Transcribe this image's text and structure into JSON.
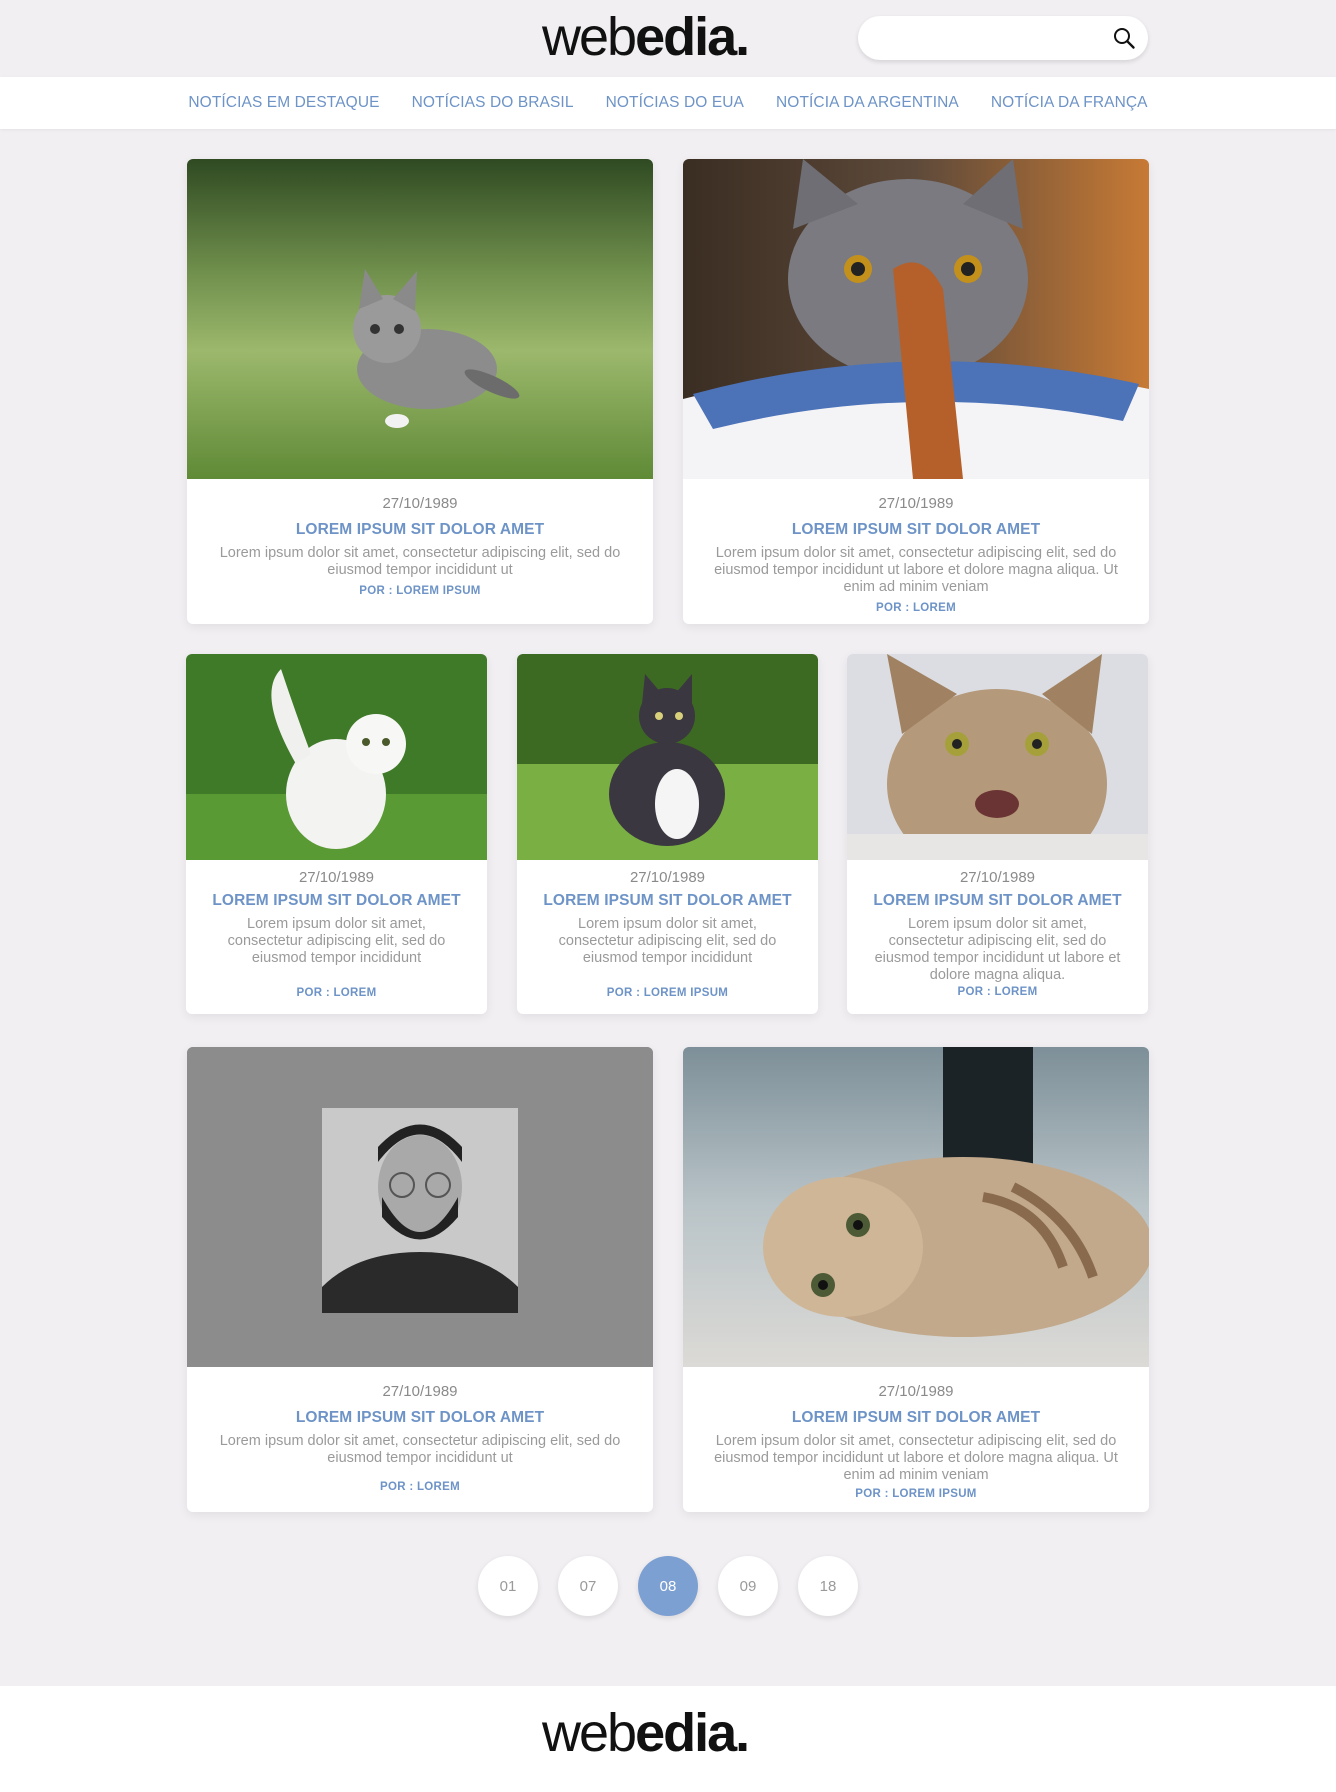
{
  "brand": {
    "logo_light": "web",
    "logo_bold": "edia",
    "logo_dot": "."
  },
  "search": {
    "placeholder": "",
    "icon": "search-icon"
  },
  "nav": {
    "items": [
      {
        "label": "NOTÍCIAS EM DESTAQUE"
      },
      {
        "label": "NOTÍCIAS DO BRASIL"
      },
      {
        "label": "NOTÍCIAS DO EUA"
      },
      {
        "label": "NOTÍCIA DA ARGENTINA"
      },
      {
        "label": "NOTÍCIA DA FRANÇA"
      }
    ]
  },
  "articles": [
    {
      "image": "kitten walking on grass",
      "date": "27/10/1989",
      "title": "LOREM IPSUM SIT DOLOR AMET",
      "excerpt": "Lorem ipsum dolor sit amet, consectetur adipiscing elit, sed do eiusmod tempor incididunt ut",
      "author": "POR : LOREM IPSUM"
    },
    {
      "image": "grey cat eating from a bowl",
      "date": "27/10/1989",
      "title": "LOREM IPSUM SIT DOLOR AMET",
      "excerpt": "Lorem ipsum dolor sit amet, consectetur adipiscing elit, sed do eiusmod tempor incididunt ut labore et dolore magna aliqua. Ut enim ad minim veniam",
      "author": "POR : LOREM"
    },
    {
      "image": "white cat running on grass",
      "date": "27/10/1989",
      "title": "LOREM IPSUM SIT DOLOR AMET",
      "excerpt": "Lorem ipsum dolor sit amet, consectetur adipiscing elit, sed do eiusmod tempor incididunt",
      "author": "POR : LOREM"
    },
    {
      "image": "black and white cat sitting on grass",
      "date": "27/10/1989",
      "title": "LOREM IPSUM SIT DOLOR AMET",
      "excerpt": "Lorem ipsum dolor sit amet, consectetur adipiscing elit, sed do eiusmod tempor incididunt",
      "author": "POR : LOREM IPSUM"
    },
    {
      "image": "tabby cat close-up",
      "date": "27/10/1989",
      "title": "LOREM IPSUM SIT DOLOR AMET",
      "excerpt": "Lorem ipsum dolor sit amet, consectetur adipiscing elit, sed do eiusmod tempor incididunt ut labore et dolore magna aliqua.",
      "author": "POR : LOREM"
    },
    {
      "image": "author portrait",
      "date": "27/10/1989",
      "title": "LOREM IPSUM SIT DOLOR AMET",
      "excerpt": "Lorem ipsum dolor sit amet, consectetur adipiscing elit, sed do eiusmod tempor incididunt ut",
      "author": "POR : LOREM"
    },
    {
      "image": "tabby cat lying on floor",
      "date": "27/10/1989",
      "title": "LOREM IPSUM SIT DOLOR AMET",
      "excerpt": "Lorem ipsum dolor sit amet, consectetur adipiscing elit, sed do eiusmod tempor incididunt ut labore et dolore magna aliqua. Ut enim ad minim veniam",
      "author": "POR : LOREM IPSUM"
    }
  ],
  "pagination": {
    "pages": [
      "01",
      "07",
      "08",
      "09",
      "18"
    ],
    "current": "08"
  },
  "colors": {
    "accent": "#6d93c7",
    "active_page": "#7da0d2",
    "background": "#f1eff2"
  }
}
